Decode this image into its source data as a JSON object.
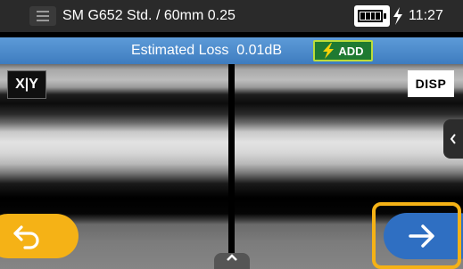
{
  "header": {
    "title": "SM G652 Std. / 60mm 0.25",
    "time": "11:27",
    "menu_icon": "hamburger-menu-icon",
    "battery_icon": "battery-full-icon",
    "charging_icon": "charging-bolt-icon"
  },
  "loss_bar": {
    "label": "Estimated Loss",
    "value": "0.01dB",
    "add_label": "ADD",
    "add_icon": "lightning-bolt-icon"
  },
  "viewer": {
    "xy_label": "X|Y",
    "disp_label": "DISP"
  },
  "nav": {
    "back_icon": "return-arrow-icon",
    "next_icon": "right-arrow-icon"
  },
  "colors": {
    "accent_orange": "#f5b216",
    "accent_blue": "#2f6fc2",
    "loss_bar_blue": "#4f8ccd",
    "add_green": "#1f7a32"
  }
}
